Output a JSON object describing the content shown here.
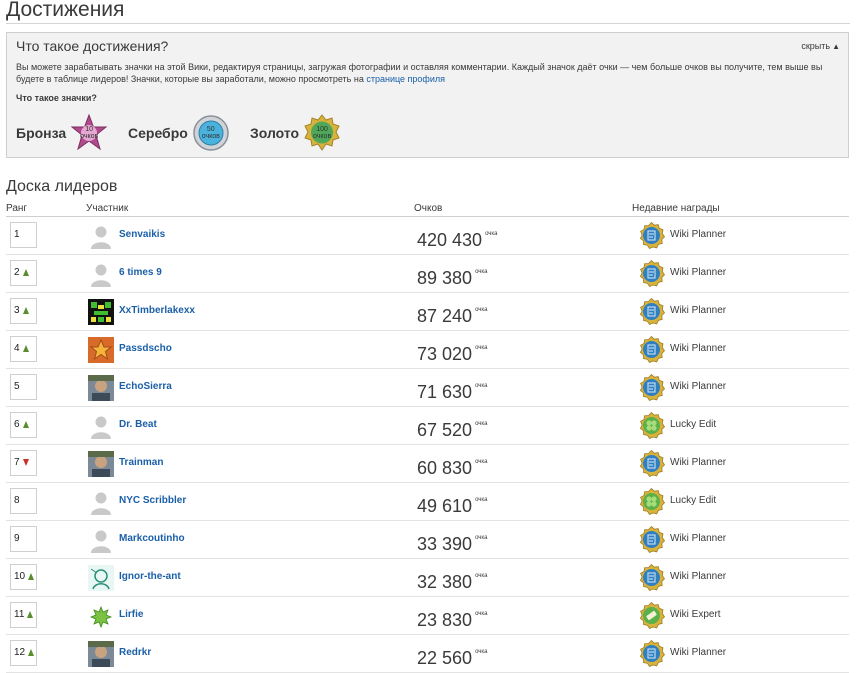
{
  "page": {
    "title": "Достижения"
  },
  "info": {
    "heading": "Что такое достижения?",
    "hide_label": "скрыть",
    "text": "Вы можете зарабатывать значки на этой Вики, редактируя страницы, загружая фотографии и оставляя комментарии. Каждый значок даёт очки — чем больше очков вы получите, тем выше вы будете в таблице лидеров! Значки, которые вы заработали, можно просмотреть на",
    "profile_link": "странице профиля",
    "badges_question": "Что такое значки?",
    "tiers": [
      {
        "label": "Бронза",
        "value": "10",
        "unit": "очков",
        "color": "#b04a8c"
      },
      {
        "label": "Серебро",
        "value": "50",
        "unit": "очков",
        "color": "#4ab3dd"
      },
      {
        "label": "Золото",
        "value": "100",
        "unit": "очков",
        "color": "#4fa85a"
      }
    ]
  },
  "leaderboard": {
    "title": "Доска лидеров",
    "columns": {
      "rank": "Ранг",
      "user": "Участник",
      "points": "Очков",
      "recent": "Недавние награды"
    },
    "points_unit": "очка",
    "rows": [
      {
        "rank": "1",
        "trend": "none",
        "user": "Senvaikis",
        "avatar": "default-avatar",
        "points": "420 430",
        "award": "Wiki Planner",
        "award_icon": "wiki-planner-badge"
      },
      {
        "rank": "2",
        "trend": "up",
        "user": "6 times 9",
        "avatar": "default-avatar",
        "points": "89 380",
        "award": "Wiki Planner",
        "award_icon": "wiki-planner-badge"
      },
      {
        "rank": "3",
        "trend": "up",
        "user": "XxTimberlakexx",
        "avatar": "pixel-art-avatar",
        "points": "87 240",
        "award": "Wiki Planner",
        "award_icon": "wiki-planner-badge"
      },
      {
        "rank": "4",
        "trend": "up",
        "user": "Passdscho",
        "avatar": "star-avatar",
        "points": "73 020",
        "award": "Wiki Planner",
        "award_icon": "wiki-planner-badge"
      },
      {
        "rank": "5",
        "trend": "none",
        "user": "EchoSierra",
        "avatar": "photo-avatar",
        "points": "71 630",
        "award": "Wiki Planner",
        "award_icon": "wiki-planner-badge"
      },
      {
        "rank": "6",
        "trend": "up",
        "user": "Dr. Beat",
        "avatar": "default-avatar",
        "points": "67 520",
        "award": "Lucky Edit",
        "award_icon": "lucky-edit-badge"
      },
      {
        "rank": "7",
        "trend": "down",
        "user": "Trainman",
        "avatar": "photo-avatar",
        "points": "60 830",
        "award": "Wiki Planner",
        "award_icon": "wiki-planner-badge"
      },
      {
        "rank": "8",
        "trend": "none",
        "user": "NYC Scribbler",
        "avatar": "default-avatar",
        "points": "49 610",
        "award": "Lucky Edit",
        "award_icon": "lucky-edit-badge"
      },
      {
        "rank": "9",
        "trend": "none",
        "user": "Markcoutinho",
        "avatar": "default-avatar",
        "points": "33 390",
        "award": "Wiki Planner",
        "award_icon": "wiki-planner-badge"
      },
      {
        "rank": "10",
        "trend": "up",
        "user": "Ignor-the-ant",
        "avatar": "sketch-avatar",
        "points": "32 380",
        "award": "Wiki Planner",
        "award_icon": "wiki-planner-badge"
      },
      {
        "rank": "11",
        "trend": "up",
        "user": "Lirfie",
        "avatar": "green-star-avatar",
        "points": "23 830",
        "award": "Wiki Expert",
        "award_icon": "wiki-expert-badge"
      },
      {
        "rank": "12",
        "trend": "up",
        "user": "Redrkr",
        "avatar": "photo-avatar",
        "points": "22 560",
        "award": "Wiki Planner",
        "award_icon": "wiki-planner-badge"
      }
    ]
  }
}
